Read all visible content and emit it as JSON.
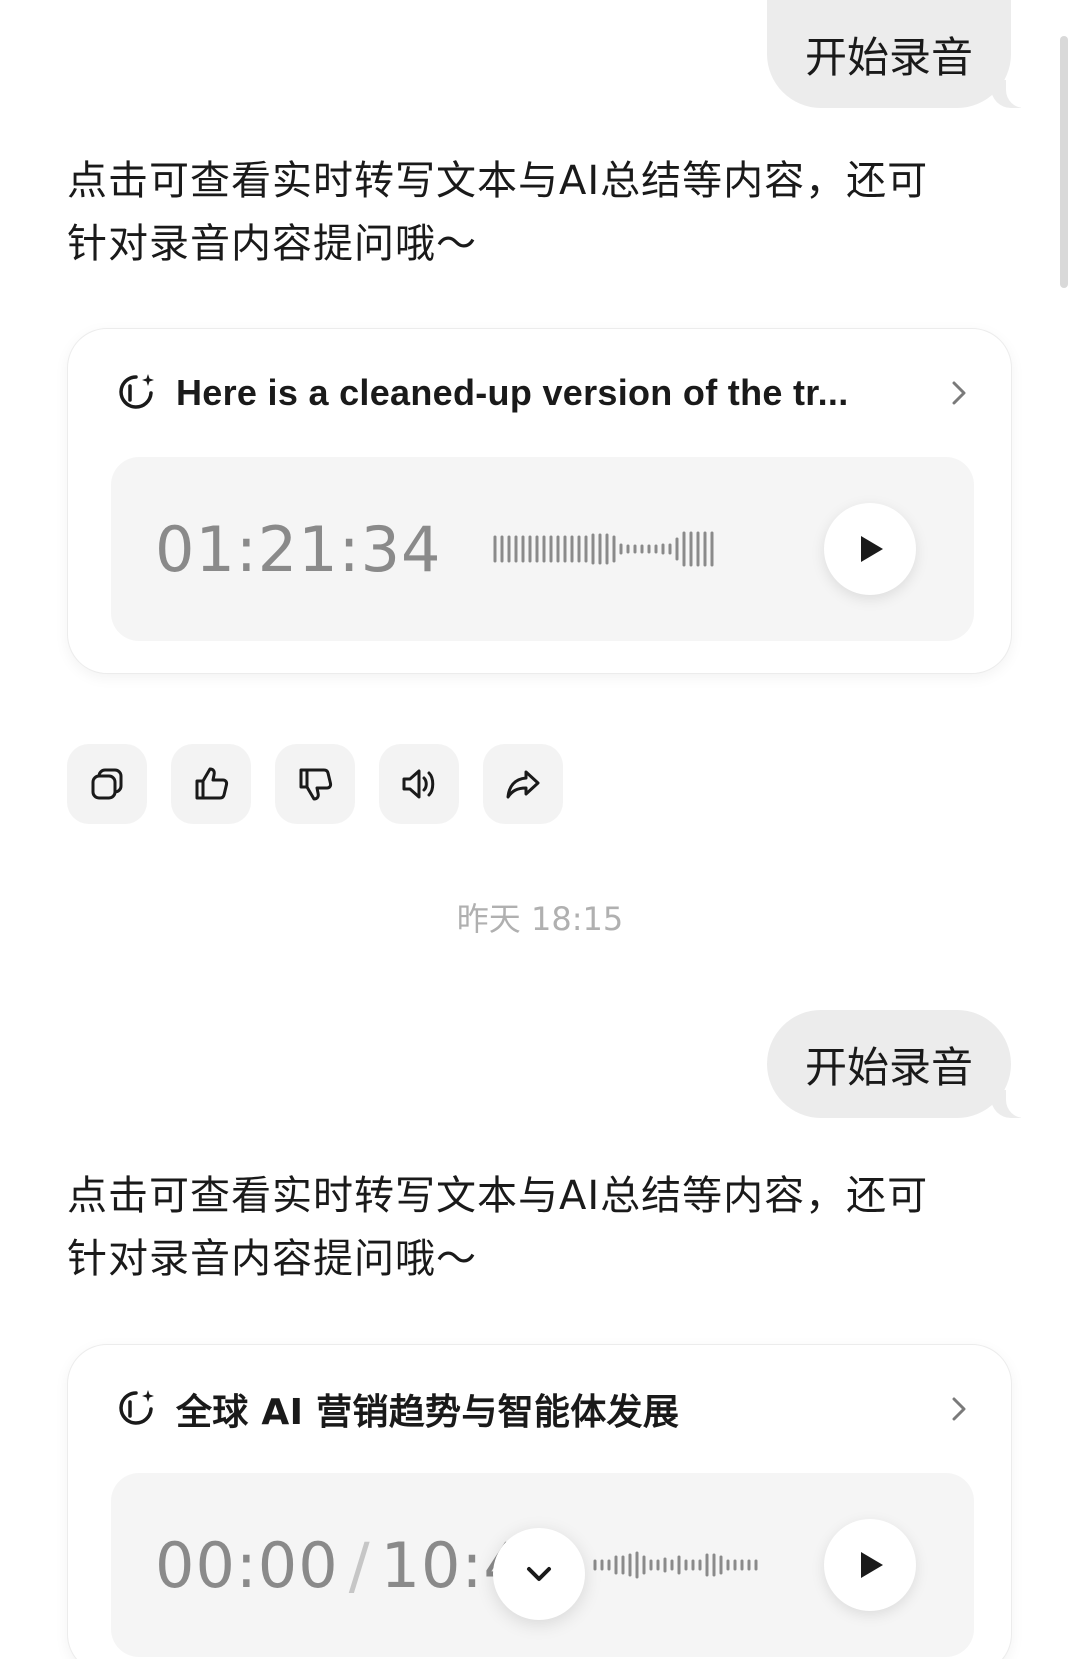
{
  "messages": [
    {
      "user_text": "开始录音",
      "assistant_line1": "点击可查看实时转写文本与AI总结等内容，还可",
      "assistant_line2": "针对录音内容提问哦～",
      "card_title": "Here is a cleaned-up version of the tr...",
      "elapsed": "01:21:34"
    },
    {
      "user_text": "开始录音",
      "assistant_line1": "点击可查看实时转写文本与AI总结等内容，还可",
      "assistant_line2": "针对录音内容提问哦～",
      "card_title": "全球 AI 营销趋势与智能体发展",
      "current": "00:00",
      "separator": "/",
      "total": "10:49"
    }
  ],
  "timestamp": "昨天 18:15",
  "actions": [
    "copy-icon",
    "thumbs-up-icon",
    "thumbs-down-icon",
    "speaker-icon",
    "share-icon"
  ],
  "colors": {
    "bubble": "#ececec",
    "card_border": "#ececec",
    "player_bg": "#f5f5f5",
    "muted": "#8a8a8a"
  }
}
